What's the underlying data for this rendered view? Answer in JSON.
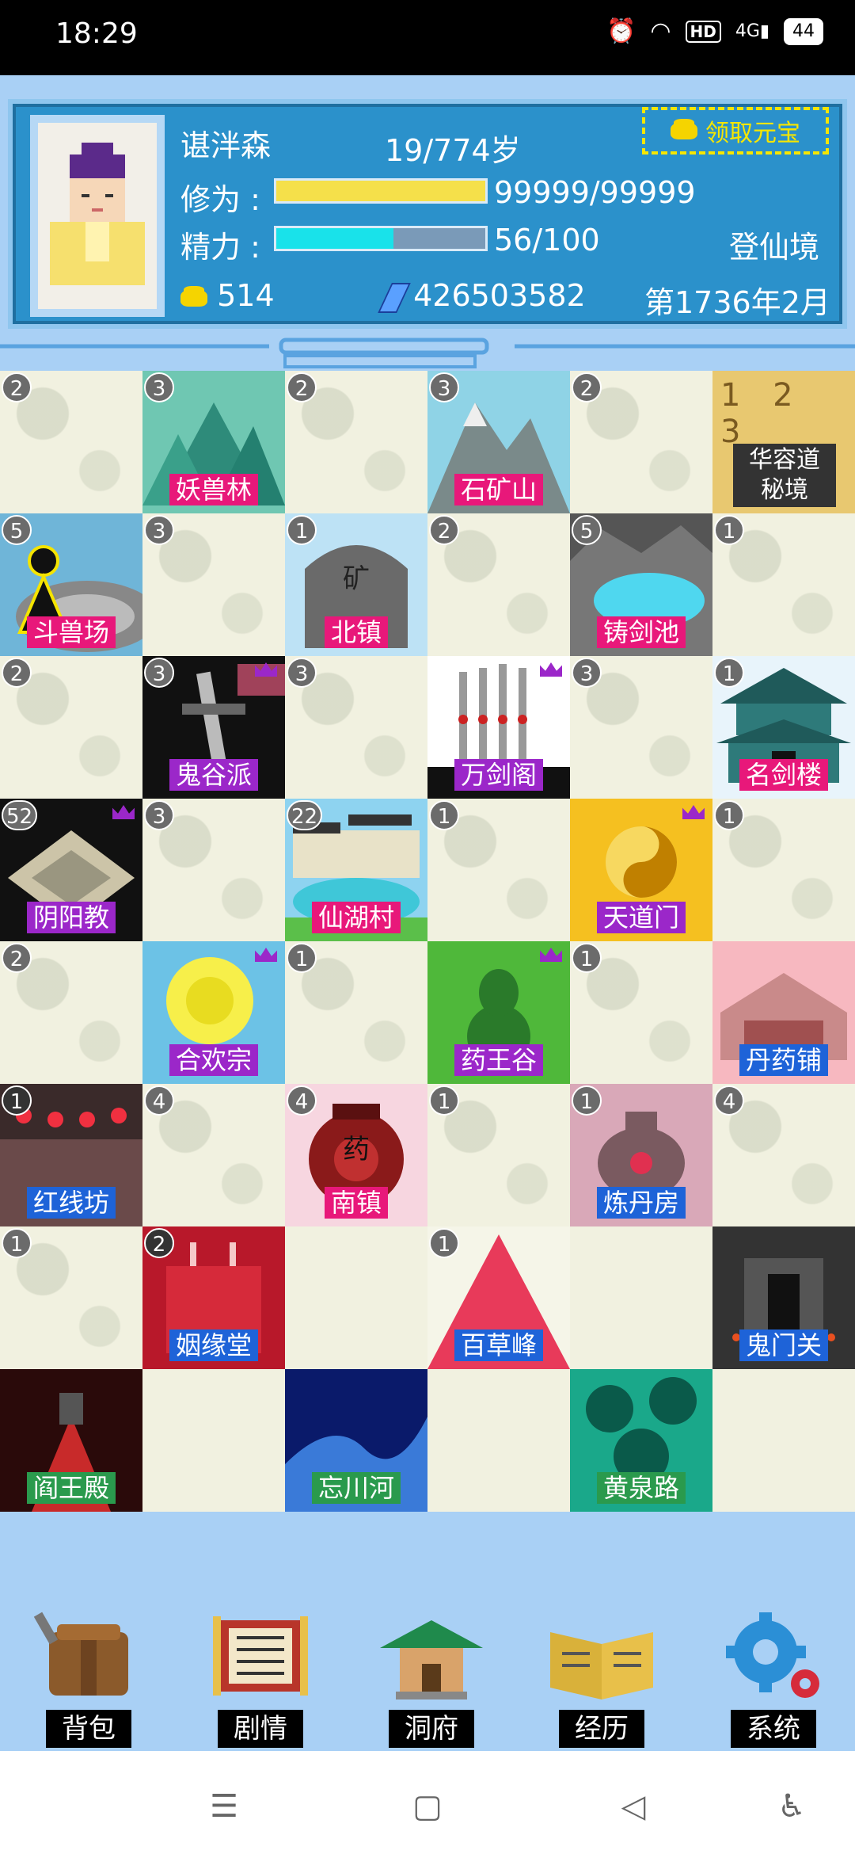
{
  "status_bar": {
    "time": "18:29",
    "battery": "44",
    "hd": "HD",
    "network": "4G"
  },
  "player": {
    "name": "谌泮森",
    "age": "19/774岁",
    "claim_label": "领取元宝",
    "cultivation_label": "修为 :",
    "cultivation_value": "99999/99999",
    "cultivation_progress": 1.0,
    "energy_label": "精力 :",
    "energy_value": "56/100",
    "energy_progress": 0.56,
    "realm": "登仙境",
    "gold": "514",
    "spirit_stones": "426503582",
    "date": "第1736年2月"
  },
  "tiles": [
    {
      "badge": "2",
      "name": "",
      "scene": "fog"
    },
    {
      "badge": "3",
      "name": "妖兽林",
      "scene": "forest",
      "label_color": "pink"
    },
    {
      "badge": "2",
      "name": "",
      "scene": "fog"
    },
    {
      "badge": "3",
      "name": "石矿山",
      "scene": "mountain",
      "label_color": "pink"
    },
    {
      "badge": "2",
      "name": "",
      "scene": "fog"
    },
    {
      "badge": "",
      "name": "华容道\n秘境",
      "scene": "puzzle",
      "puzzle_digits": "1 2 3"
    },
    {
      "badge": "5",
      "name": "斗兽场",
      "scene": "arena",
      "label_color": "pink"
    },
    {
      "badge": "3",
      "name": "",
      "scene": "fog"
    },
    {
      "badge": "1",
      "name": "北镇",
      "scene": "stone",
      "label_color": "pink",
      "stone_text": "矿"
    },
    {
      "badge": "2",
      "name": "",
      "scene": "fog"
    },
    {
      "badge": "5",
      "name": "铸剑池",
      "scene": "pool",
      "label_color": "pink"
    },
    {
      "badge": "1",
      "name": "",
      "scene": "fog"
    },
    {
      "badge": "2",
      "name": "",
      "scene": "fog"
    },
    {
      "badge": "3",
      "name": "鬼谷派",
      "scene": "sword",
      "label_color": "purple",
      "crown": true
    },
    {
      "badge": "3",
      "name": "",
      "scene": "fog"
    },
    {
      "badge": "",
      "name": "万剑阁",
      "scene": "swords",
      "label_color": "purple",
      "crown": true
    },
    {
      "badge": "3",
      "name": "",
      "scene": "fog"
    },
    {
      "badge": "1",
      "name": "名剑楼",
      "scene": "pagoda",
      "label_color": "pink"
    },
    {
      "badge": "52",
      "name": "阴阳教",
      "scene": "altar",
      "label_color": "purple",
      "crown": true
    },
    {
      "badge": "3",
      "name": "",
      "scene": "fog"
    },
    {
      "badge": "22",
      "name": "仙湖村",
      "scene": "village",
      "label_color": "pink"
    },
    {
      "badge": "1",
      "name": "",
      "scene": "fog"
    },
    {
      "badge": "",
      "name": "天道门",
      "scene": "taiji",
      "label_color": "purple",
      "crown": true
    },
    {
      "badge": "1",
      "name": "",
      "scene": "fog"
    },
    {
      "badge": "2",
      "name": "",
      "scene": "fog"
    },
    {
      "badge": "",
      "name": "合欢宗",
      "scene": "rose",
      "label_color": "purple",
      "crown": true
    },
    {
      "badge": "1",
      "name": "",
      "scene": "fog"
    },
    {
      "badge": "",
      "name": "药王谷",
      "scene": "gourd",
      "label_color": "purple",
      "crown": true
    },
    {
      "badge": "1",
      "name": "",
      "scene": "fog"
    },
    {
      "badge": "",
      "name": "丹药铺",
      "scene": "shop",
      "label_color": "blue"
    },
    {
      "badge": "1",
      "name": "红线坊",
      "scene": "lantern",
      "label_color": "blue",
      "dark": true
    },
    {
      "badge": "4",
      "name": "",
      "scene": "fog"
    },
    {
      "badge": "4",
      "name": "南镇",
      "scene": "jar",
      "label_color": "pink",
      "jar_text": "药"
    },
    {
      "badge": "1",
      "name": "",
      "scene": "fog"
    },
    {
      "badge": "1",
      "name": "炼丹房",
      "scene": "cauldron",
      "label_color": "blue"
    },
    {
      "badge": "4",
      "name": "",
      "scene": "fog"
    },
    {
      "badge": "1",
      "name": "",
      "scene": "fog"
    },
    {
      "badge": "2",
      "name": "姻缘堂",
      "scene": "wedding",
      "label_color": "blue",
      "dark": true
    },
    {
      "badge": "",
      "name": "",
      "scene": "empty"
    },
    {
      "badge": "1",
      "name": "百草峰",
      "scene": "peak",
      "label_color": "blue"
    },
    {
      "badge": "",
      "name": "",
      "scene": "empty"
    },
    {
      "badge": "",
      "name": "鬼门关",
      "scene": "gate",
      "label_color": "blue"
    },
    {
      "badge": "",
      "name": "阎王殿",
      "scene": "hall",
      "label_color": "green"
    },
    {
      "badge": "",
      "name": "",
      "scene": "empty"
    },
    {
      "badge": "",
      "name": "忘川河",
      "scene": "river",
      "label_color": "green"
    },
    {
      "badge": "",
      "name": "",
      "scene": "empty"
    },
    {
      "badge": "",
      "name": "黄泉路",
      "scene": "yellow",
      "label_color": "green"
    },
    {
      "badge": "",
      "name": "",
      "scene": "empty"
    }
  ],
  "menu": [
    {
      "label": "背包",
      "icon": "bag-icon"
    },
    {
      "label": "剧情",
      "icon": "scroll-icon"
    },
    {
      "label": "洞府",
      "icon": "house-icon"
    },
    {
      "label": "经历",
      "icon": "book-icon"
    },
    {
      "label": "系统",
      "icon": "gear-icon"
    }
  ]
}
